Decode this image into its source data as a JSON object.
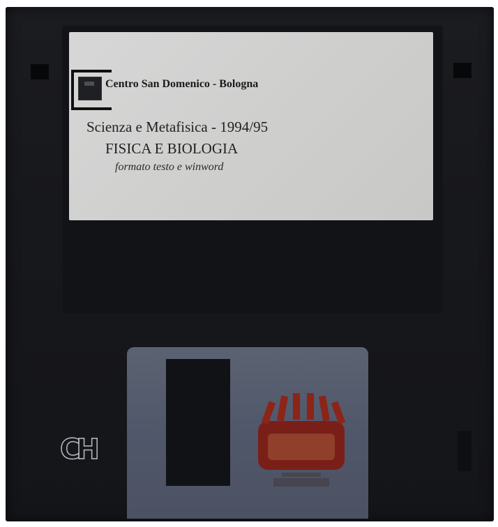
{
  "label": {
    "organization": "Centro San Domenico - Bologna",
    "course": "Scienza e Metafisica - 1994/95",
    "topic": "FISICA E BIOLOGIA",
    "format": "formato testo e winword"
  },
  "disk_brand": "CH",
  "colors": {
    "disk_body": "#17181c",
    "label_paper": "#d0d0cf",
    "shutter": "#545b6b"
  },
  "icons": {
    "logo": "square-logo-icon",
    "brand": "ch-logo-icon",
    "shutter_art": "crown-badge-icon"
  }
}
